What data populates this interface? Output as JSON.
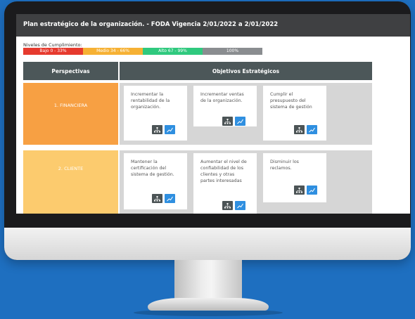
{
  "page": {
    "title": "Plan estratégico de la organización. - FODA Vigencia 2/01/2022 a 2/01/2022",
    "levels_label": "Niveles de Cumplimiento:",
    "levels": [
      {
        "label": "Bajo 0 - 33%",
        "color": "#e63a2e"
      },
      {
        "label": "Medio 34 - 66%",
        "color": "#f6b134"
      },
      {
        "label": "Alto 67 - 99%",
        "color": "#2fc97e"
      },
      {
        "label": "100%",
        "color": "#8a8d90"
      }
    ]
  },
  "table": {
    "col_perspectives": "Perspectivas",
    "col_objectives": "Objetivos Estratégicos"
  },
  "perspectives": [
    {
      "name": "1. FINANCIERA",
      "color": "#f7a043",
      "objectives": [
        "Incrementar la rentabilidad de la organización.",
        "Incrementar ventas de la organización.",
        "Cumplir el presupuesto del sistema de gestión"
      ]
    },
    {
      "name": "2. CLIENTE",
      "color": "#fccb6e",
      "objectives": [
        "Mantener la certificación del sistema de gestión.",
        "Aumentar el nivel de confiabilidad de los clientes y otras partes interesadas",
        "Disminuir los reclamos."
      ]
    }
  ],
  "icons": {
    "hierarchy": "hierarchy-icon",
    "chart": "chart-icon"
  }
}
